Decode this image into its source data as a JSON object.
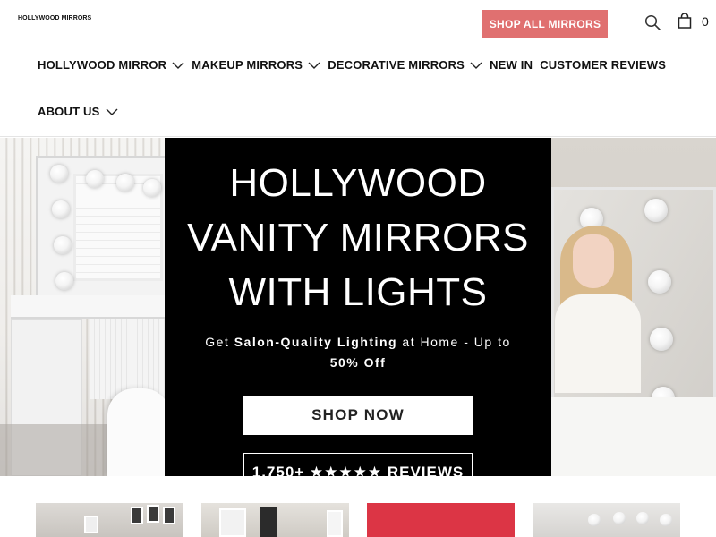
{
  "header": {
    "logo_text": "HOLLYWOOD MIRRORS",
    "shop_all_label": "SHOP ALL MIRRORS",
    "cart_count": "0",
    "accent_color": "#e07070"
  },
  "nav": {
    "row1": [
      {
        "label": "HOLLYWOOD MIRROR",
        "has_dropdown": true
      },
      {
        "label": "MAKEUP MIRRORS",
        "has_dropdown": true
      },
      {
        "label": "DECORATIVE MIRRORS",
        "has_dropdown": true
      },
      {
        "label": "NEW IN",
        "has_dropdown": false
      },
      {
        "label": "CUSTOMER REVIEWS",
        "has_dropdown": false
      }
    ],
    "row2": [
      {
        "label": "ABOUT US",
        "has_dropdown": true
      }
    ]
  },
  "hero": {
    "title_line1": "HOLLYWOOD",
    "title_line2": "VANITY MIRRORS",
    "title_line3": "WITH LIGHTS",
    "subtitle_prefix": "Get ",
    "subtitle_bold": "Salon-Quality Lighting",
    "subtitle_middle": " at Home - Up to",
    "subtitle_bold2": "50% Off",
    "shop_now_label": "SHOP NOW",
    "reviews_label": "1,750+ ★★★★★ REVIEWS"
  },
  "icons": {
    "search": "search-icon",
    "cart": "cart-icon",
    "chevron": "chevron-down-icon"
  }
}
